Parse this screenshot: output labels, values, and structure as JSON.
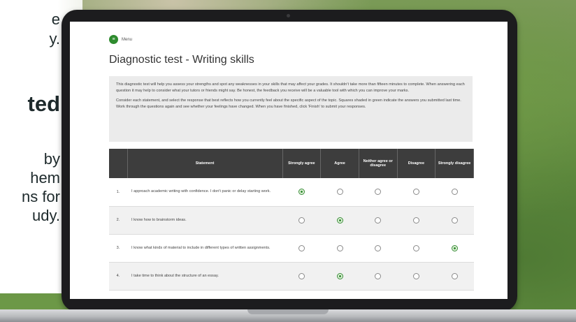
{
  "side_text": {
    "line1": "e",
    "line2": "y.",
    "heading": "ted",
    "line3": "by",
    "line4": "hem",
    "line5": "ns for",
    "line6": "udy."
  },
  "screen": {
    "menu_label": "Menu",
    "title": "Diagnostic test - Writing skills",
    "intro_p1": "This diagnostic test will help you assess your strengths and spot any weaknesses in your skills that may affect your grades. It shouldn't take more than fifteen minutes to complete. When answering each question it may help to consider what your tutors or friends might say. Be honest, the feedback you receive will be a valuable tool with which you can improve your marks.",
    "intro_p2": "Consider each statement, and select the response that best reflects how you currently feel about the specific aspect of the topic. Squares shaded in green indicate the answers you submitted last time. Work through the questions again and see whether your feelings have changed. When you have finished, click 'Finish' to submit your responses.",
    "columns": [
      "Statement",
      "Strongly agree",
      "Agree",
      "Neither agree or disagree",
      "Disagree",
      "Strongly disagree"
    ],
    "rows": [
      {
        "num": "1.",
        "statement": "I approach academic writing with confidence. I don't panic or delay starting work.",
        "selected": 0
      },
      {
        "num": "2.",
        "statement": "I know how to brainstorm ideas.",
        "selected": 1
      },
      {
        "num": "3.",
        "statement": "I know what kinds of material to include in different types of written assignments.",
        "selected": 4
      },
      {
        "num": "4.",
        "statement": "I take time to think about the structure of an essay.",
        "selected": 1
      }
    ]
  },
  "colors": {
    "accent_green": "#2e8b2e",
    "header_dark": "#3d3d3d",
    "bezel": "#1c1c1e"
  },
  "icons": {
    "menu": "menu-icon"
  }
}
